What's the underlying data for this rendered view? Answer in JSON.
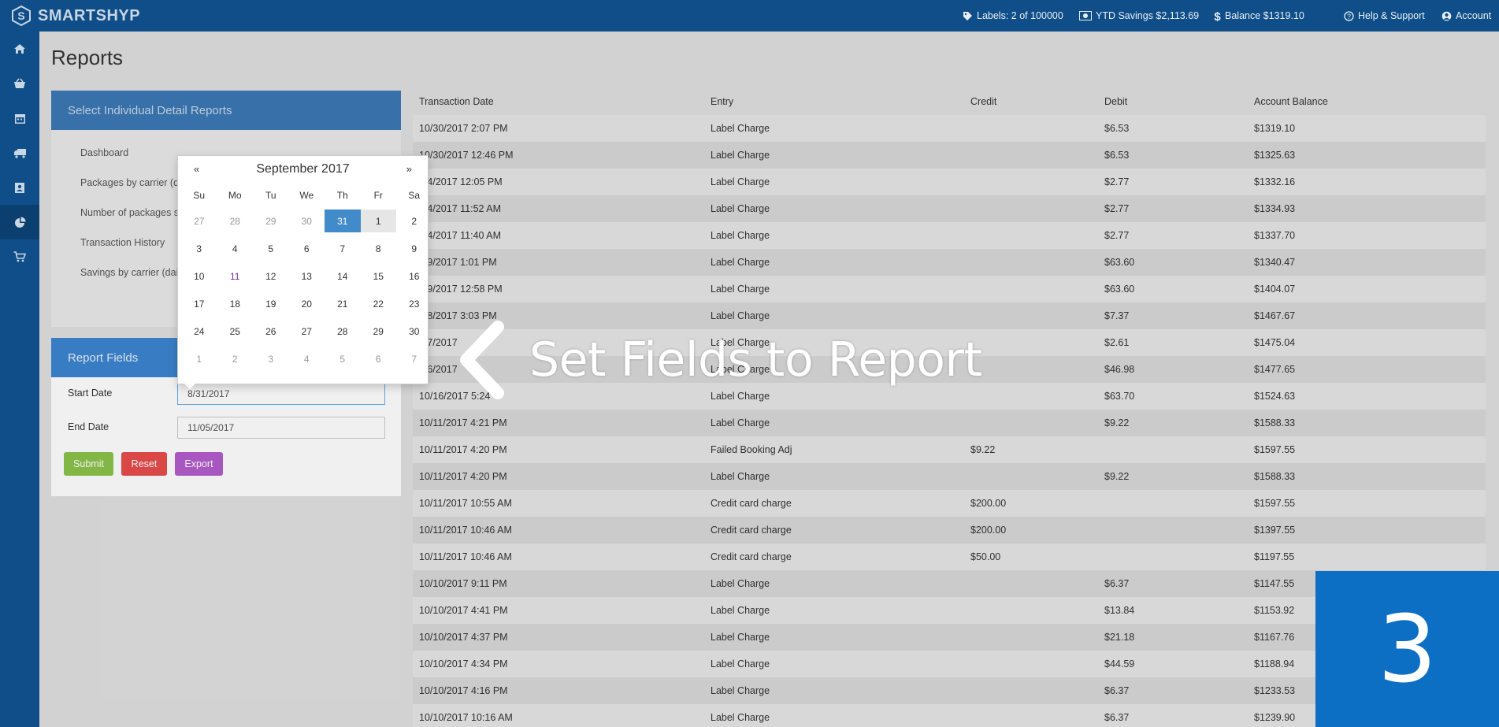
{
  "app": {
    "brand": "SMARTSHYP"
  },
  "header": {
    "labels": "Labels: 2 of 100000",
    "ytd_savings": "YTD Savings $2,113.69",
    "balance": "Balance $1319.10",
    "help": "Help & Support",
    "account": "Account"
  },
  "sidebar": {
    "items": [
      {
        "icon": "home-icon"
      },
      {
        "icon": "basket-icon"
      },
      {
        "icon": "calendar-icon"
      },
      {
        "icon": "truck-icon"
      },
      {
        "icon": "address-book-icon"
      },
      {
        "icon": "pie-chart-icon"
      },
      {
        "icon": "cart-icon"
      }
    ]
  },
  "page": {
    "title": "Reports"
  },
  "reports_panel": {
    "title": "Select Individual Detail Reports",
    "items": [
      "Dashboard",
      "Packages by carrier (da",
      "Number of packages sh",
      "Transaction History",
      "Savings by carrier (daily"
    ]
  },
  "fields_panel": {
    "title": "Report Fields",
    "start_label": "Start Date",
    "start_value": "8/31/2017",
    "end_label": "End Date",
    "end_value": "11/05/2017",
    "submit": "Submit",
    "reset": "Reset",
    "export": "Export"
  },
  "datepicker": {
    "title": "September 2017",
    "prev": "«",
    "next": "»",
    "dow": [
      "Su",
      "Mo",
      "Tu",
      "We",
      "Th",
      "Fr",
      "Sa"
    ],
    "days": [
      [
        "27",
        "28",
        "29",
        "30",
        "31",
        "1",
        "2"
      ],
      [
        "3",
        "4",
        "5",
        "6",
        "7",
        "8",
        "9"
      ],
      [
        "10",
        "11",
        "12",
        "13",
        "14",
        "15",
        "16"
      ],
      [
        "17",
        "18",
        "19",
        "20",
        "21",
        "22",
        "23"
      ],
      [
        "24",
        "25",
        "26",
        "27",
        "28",
        "29",
        "30"
      ],
      [
        "1",
        "2",
        "3",
        "4",
        "5",
        "6",
        "7"
      ]
    ]
  },
  "table": {
    "headers": [
      "Transaction Date",
      "Entry",
      "Credit",
      "Debit",
      "Account Balance"
    ],
    "rows": [
      [
        "10/30/2017 2:07 PM",
        "Label Charge",
        "",
        "$6.53",
        "$1319.10"
      ],
      [
        "10/30/2017 12:46 PM",
        "Label Charge",
        "",
        "$6.53",
        "$1325.63"
      ],
      [
        "/24/2017 12:05 PM",
        "Label Charge",
        "",
        "$2.77",
        "$1332.16"
      ],
      [
        "/24/2017 11:52 AM",
        "Label Charge",
        "",
        "$2.77",
        "$1334.93"
      ],
      [
        "/24/2017 11:40 AM",
        "Label Charge",
        "",
        "$2.77",
        "$1337.70"
      ],
      [
        "/19/2017 1:01 PM",
        "Label Charge",
        "",
        "$63.60",
        "$1340.47"
      ],
      [
        "/19/2017 12:58 PM",
        "Label Charge",
        "",
        "$63.60",
        "$1404.07"
      ],
      [
        "/18/2017 3:03 PM",
        "Label Charge",
        "",
        "$7.37",
        "$1467.67"
      ],
      [
        "/17/2017",
        "Label Charge",
        "",
        "$2.61",
        "$1475.04"
      ],
      [
        "/16/2017",
        "Label Charge",
        "",
        "$46.98",
        "$1477.65"
      ],
      [
        "10/16/2017 5:24",
        "Label Charge",
        "",
        "$63.70",
        "$1524.63"
      ],
      [
        "10/11/2017 4:21 PM",
        "Label Charge",
        "",
        "$9.22",
        "$1588.33"
      ],
      [
        "10/11/2017 4:20 PM",
        "Failed Booking Adj",
        "$9.22",
        "",
        "$1597.55"
      ],
      [
        "10/11/2017 4:20 PM",
        "Label Charge",
        "",
        "$9.22",
        "$1588.33"
      ],
      [
        "10/11/2017 10:55 AM",
        "Credit card charge",
        "$200.00",
        "",
        "$1597.55"
      ],
      [
        "10/11/2017 10:46 AM",
        "Credit card charge",
        "$200.00",
        "",
        "$1397.55"
      ],
      [
        "10/11/2017 10:46 AM",
        "Credit card charge",
        "$50.00",
        "",
        "$1197.55"
      ],
      [
        "10/10/2017 9:11 PM",
        "Label Charge",
        "",
        "$6.37",
        "$1147.55"
      ],
      [
        "10/10/2017 4:41 PM",
        "Label Charge",
        "",
        "$13.84",
        "$1153.92"
      ],
      [
        "10/10/2017 4:37 PM",
        "Label Charge",
        "",
        "$21.18",
        "$1167.76"
      ],
      [
        "10/10/2017 4:34 PM",
        "Label Charge",
        "",
        "$44.59",
        "$1188.94"
      ],
      [
        "10/10/2017 4:16 PM",
        "Label Charge",
        "",
        "$6.37",
        "$1233.53"
      ],
      [
        "10/10/2017 10:16 AM",
        "Label Charge",
        "",
        "$6.37",
        "$1239.90"
      ]
    ]
  },
  "annotation": {
    "text": "Set Fields to Report",
    "step": "3"
  },
  "colors": {
    "brand": "#0f4e88",
    "accent": "#3c85d0",
    "submit": "#8bc34a",
    "reset": "#e84c4c",
    "export": "#b45dcc",
    "badge": "#0c6fc4"
  }
}
